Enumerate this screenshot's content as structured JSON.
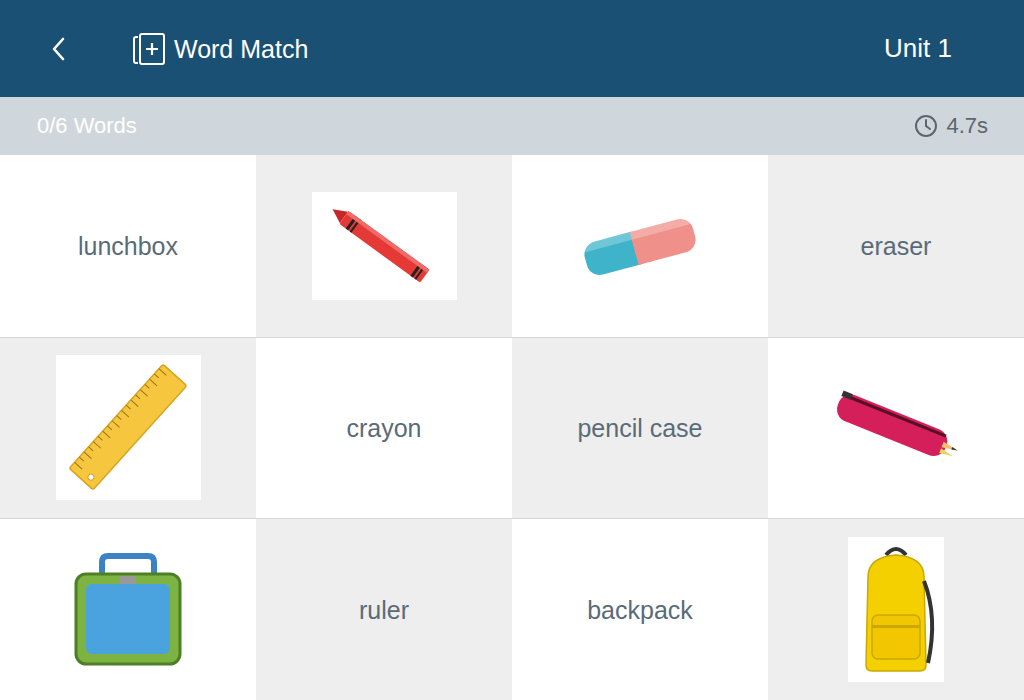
{
  "header": {
    "title": "Word Match",
    "unit": "Unit 1"
  },
  "status": {
    "progress": "0/6 Words",
    "time": "4.7s"
  },
  "cells": [
    {
      "kind": "word",
      "text": "lunchbox"
    },
    {
      "kind": "picture"
    },
    {
      "kind": "picture"
    },
    {
      "kind": "word",
      "text": "eraser"
    },
    {
      "kind": "picture"
    },
    {
      "kind": "word",
      "text": "crayon"
    },
    {
      "kind": "word",
      "text": "pencil case"
    },
    {
      "kind": "picture"
    },
    {
      "kind": "picture"
    },
    {
      "kind": "word",
      "text": "ruler"
    },
    {
      "kind": "word",
      "text": "backpack"
    },
    {
      "kind": "picture"
    }
  ]
}
